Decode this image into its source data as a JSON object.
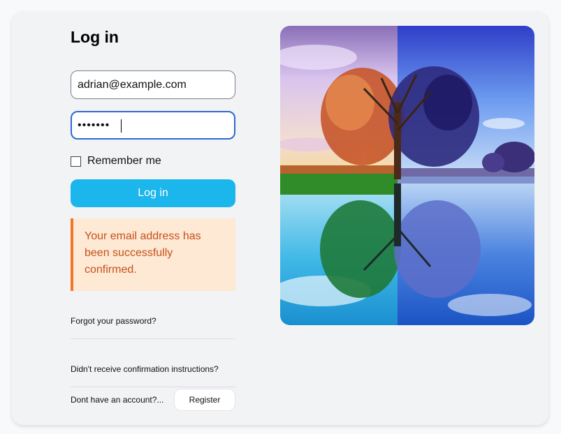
{
  "page": {
    "title": "Log in"
  },
  "form": {
    "email_value": "adrian@example.com",
    "password_masked": "•••••••",
    "remember_label": "Remember me",
    "login_label": "Log in"
  },
  "alert": {
    "message": "Your email address has been successfully confirmed."
  },
  "links": {
    "forgot": "Forgot your password?",
    "confirm": "Didn't receive confirmation instructions?",
    "no_account": "Dont have an account?...",
    "register": "Register"
  },
  "image": {
    "subject": "four-seasons-tree-reflection"
  },
  "colors": {
    "primary": "#1bb6ec",
    "focus": "#2f67d4",
    "alert_bg": "#fde9d4",
    "alert_border": "#f3752a",
    "alert_text": "#c8501c"
  }
}
